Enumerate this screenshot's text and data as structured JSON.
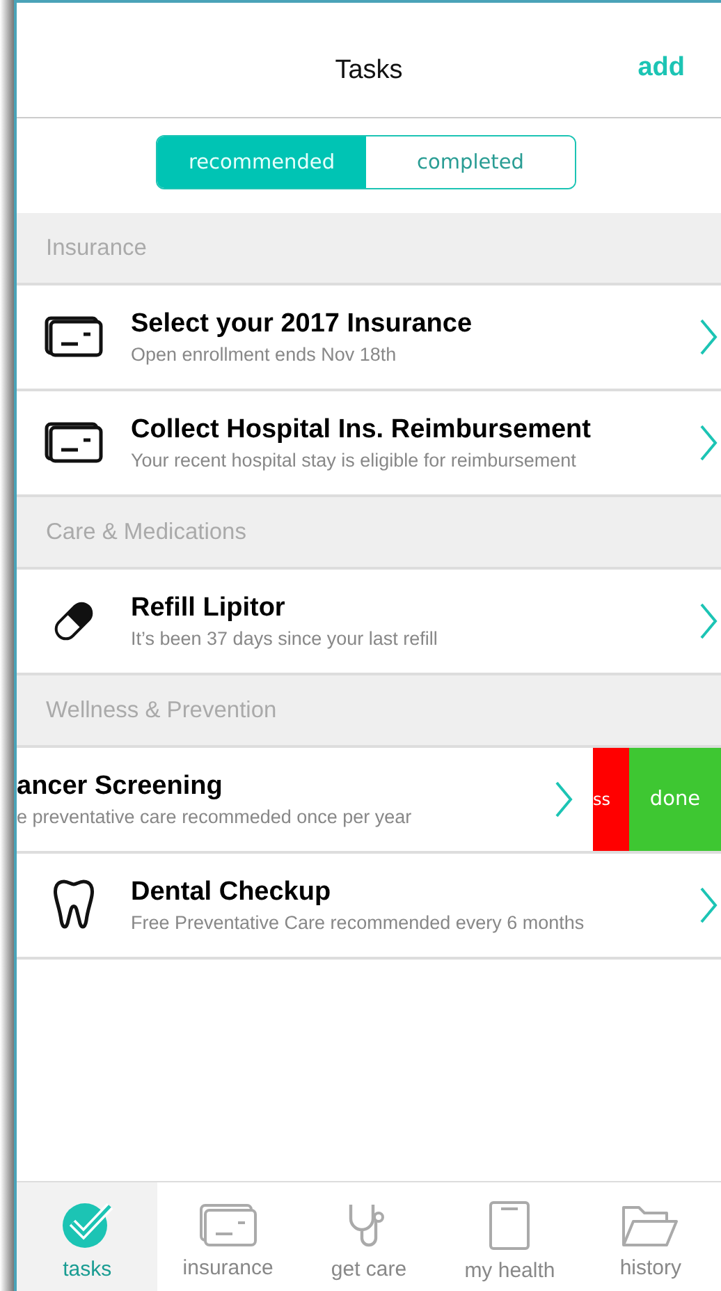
{
  "header": {
    "title": "Tasks",
    "action": "add"
  },
  "segments": [
    {
      "label": "recommended",
      "selected": true
    },
    {
      "label": "completed",
      "selected": false
    }
  ],
  "sections": [
    {
      "title": "Insurance",
      "tasks": [
        {
          "kind": "card",
          "title": "Select your 2017 Insurance",
          "subtitle": "Open enrollment ends Nov 18th"
        },
        {
          "kind": "card",
          "title": "Collect Hospital Ins. Reimbursement",
          "subtitle": "Your recent hospital stay is eligible for reimbursement"
        }
      ]
    },
    {
      "title": "Care & Medications",
      "tasks": [
        {
          "kind": "pill",
          "title": "Refill Lipitor",
          "subtitle": "It’s been 37 days since your last refill"
        }
      ]
    },
    {
      "title": "Wellness & Prevention",
      "tasks": [
        {
          "kind": "swiped",
          "title": "ancer Screening",
          "subtitle": "e preventative care recommeded once per year",
          "actions": [
            {
              "kind": "dismiss",
              "label": "ss"
            },
            {
              "kind": "done",
              "label": "done"
            }
          ]
        },
        {
          "kind": "tooth",
          "title": "Dental Checkup",
          "subtitle": "Free Preventative Care recommended every 6 months"
        }
      ]
    }
  ],
  "tabs": [
    {
      "kind": "check",
      "label": "tasks",
      "selected": true
    },
    {
      "kind": "card",
      "label": "insurance",
      "selected": false
    },
    {
      "kind": "stethoscope",
      "label": "get care",
      "selected": false
    },
    {
      "kind": "clipboard",
      "label": "my health",
      "selected": false
    },
    {
      "kind": "folder",
      "label": "history",
      "selected": false
    }
  ]
}
